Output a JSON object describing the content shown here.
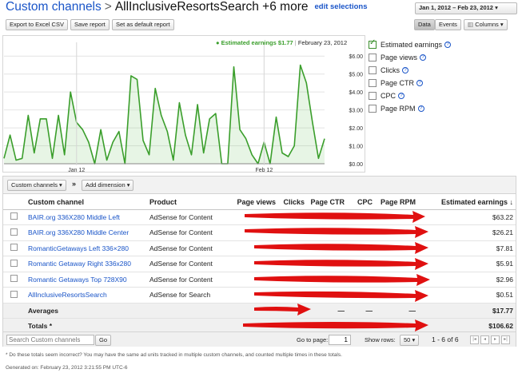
{
  "header": {
    "breadcrumb_root": "Custom channels",
    "separator": ">",
    "current": "AllInclusiveResortsSearch +6 more",
    "edit_link": "edit selections",
    "date_range": "Jan 1, 2012 – Feb 23, 2012"
  },
  "toolbar": {
    "export": "Export to Excel CSV",
    "save": "Save report",
    "default": "Set as default report",
    "data_tab": "Data",
    "events_tab": "Events",
    "columns": "Columns"
  },
  "chart_legend": {
    "marker": "●",
    "label": "Estimated earnings",
    "value": "$1.77",
    "sep": "|",
    "date": "February 23, 2012"
  },
  "chart_data": {
    "type": "area",
    "series": [
      {
        "name": "Estimated earnings",
        "color": "#3a9e2b"
      }
    ],
    "y_ticks": [
      "$6.00",
      "$5.00",
      "$4.00",
      "$3.00",
      "$2.00",
      "$1.00",
      "$0.00"
    ],
    "ylim": [
      0,
      6.5
    ],
    "x_tick_labels": [
      {
        "label": "Jan 12",
        "day": 12
      },
      {
        "label": "Feb 12",
        "day": 43
      }
    ],
    "values": [
      0.3,
      1.6,
      0.2,
      0.3,
      2.7,
      0.6,
      2.5,
      2.5,
      0.3,
      2.7,
      0.5,
      4.0,
      2.3,
      1.9,
      1.2,
      0.0,
      1.9,
      0.2,
      1.2,
      1.8,
      0.0,
      4.9,
      4.7,
      1.3,
      0.5,
      4.2,
      2.7,
      1.8,
      0.2,
      3.4,
      1.6,
      0.5,
      3.3,
      0.6,
      2.5,
      2.8,
      0.0,
      0.0,
      5.4,
      1.9,
      1.4,
      0.5,
      0.0,
      1.2,
      0.0,
      2.6,
      0.6,
      0.4,
      1.0,
      5.5,
      4.5,
      2.3,
      0.3,
      1.4
    ]
  },
  "metrics": [
    {
      "label": "Estimated earnings",
      "checked": true
    },
    {
      "label": "Page views",
      "checked": false
    },
    {
      "label": "Clicks",
      "checked": false
    },
    {
      "label": "Page CTR",
      "checked": false
    },
    {
      "label": "CPC",
      "checked": false
    },
    {
      "label": "Page RPM",
      "checked": false
    }
  ],
  "metric_help": "?",
  "dimension_bar": {
    "dim_button": "Custom channels",
    "separator": "»",
    "add_dimension": "Add dimension"
  },
  "table": {
    "headers": {
      "channel": "Custom channel",
      "product": "Product",
      "page_views": "Page views",
      "clicks": "Clicks",
      "page_ctr": "Page CTR",
      "cpc": "CPC",
      "page_rpm": "Page RPM",
      "earnings": "Estimated earnings"
    },
    "rows": [
      {
        "channel": "BAIR.org 336X280 Middle Left",
        "product": "AdSense for Content",
        "earnings": "$63.22"
      },
      {
        "channel": "BAIR.org 336X280 Middle Center",
        "product": "AdSense for Content",
        "earnings": "$26.21"
      },
      {
        "channel": "RomanticGetaways Left 336×280",
        "product": "AdSense for Content",
        "earnings": "$7.81"
      },
      {
        "channel": "Romantic Getaway Right 336x280",
        "product": "AdSense for Content",
        "earnings": "$5.91"
      },
      {
        "channel": "Romantic Getaways Top 728X90",
        "product": "AdSense for Content",
        "earnings": "$2.96"
      },
      {
        "channel": "AllInclusiveResortsSearch",
        "product": "AdSense for Search",
        "earnings": "$0.51"
      }
    ],
    "averages": {
      "label": "Averages",
      "page_ctr": "—",
      "cpc": "—",
      "page_rpm": "—",
      "earnings": "$17.77"
    },
    "totals": {
      "label": "Totals *",
      "earnings": "$106.62"
    }
  },
  "pager": {
    "search_placeholder": "Search Custom channels",
    "go": "Go",
    "goto_label": "Go to page:",
    "page": "1",
    "show_rows_label": "Show rows:",
    "rows_value": "50",
    "range": "1 - 6 of 6"
  },
  "footnote": "* Do these totals seem incorrect? You may have the same ad units tracked in multiple custom channels, and counted multiple times in these totals.",
  "generated": "Generated on: February 23, 2012 3:21:55 PM UTC-6"
}
